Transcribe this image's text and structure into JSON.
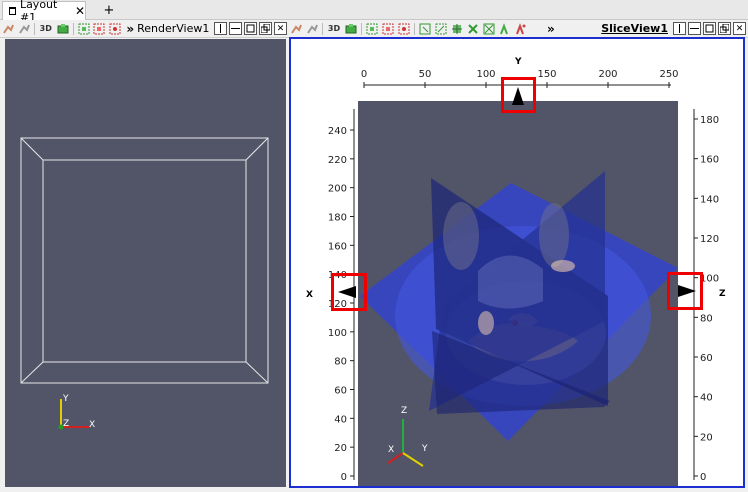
{
  "tabs": {
    "layout_label": "Layout #1",
    "close_glyph": "✕",
    "add_label": "+"
  },
  "left_toolbar": {
    "label_3d": "3D",
    "chevron": "»",
    "view_name": "RenderView1"
  },
  "right_toolbar": {
    "label_3d": "3D",
    "chevron": "»",
    "view_name": "SliceView1"
  },
  "view_buttons": [
    "split-horizontal-icon",
    "split-vertical-icon",
    "maximize-icon",
    "restore-icon",
    "close-icon"
  ],
  "render_view": {
    "axis_labels": {
      "x": "X",
      "y": "Y",
      "z": "Z"
    }
  },
  "slice_view": {
    "top_axis": {
      "title": "Y",
      "ticks": [
        "0",
        "50",
        "100",
        "150",
        "200",
        "250"
      ]
    },
    "left_axis": {
      "title": "X",
      "ticks": [
        "240",
        "220",
        "200",
        "180",
        "160",
        "140",
        "120",
        "100",
        "80",
        "60",
        "40",
        "20",
        "0"
      ]
    },
    "right_axis": {
      "title": "Z",
      "ticks": [
        "180",
        "160",
        "140",
        "120",
        "100",
        "80",
        "60",
        "40",
        "20",
        "0"
      ]
    },
    "orientation_labels": {
      "x": "X",
      "y": "Y",
      "z": "Z"
    }
  },
  "colors": {
    "background": "#525568",
    "active_border": "#1b2ecf",
    "marker": "#e00000",
    "plane_blue": "#3344cc"
  }
}
